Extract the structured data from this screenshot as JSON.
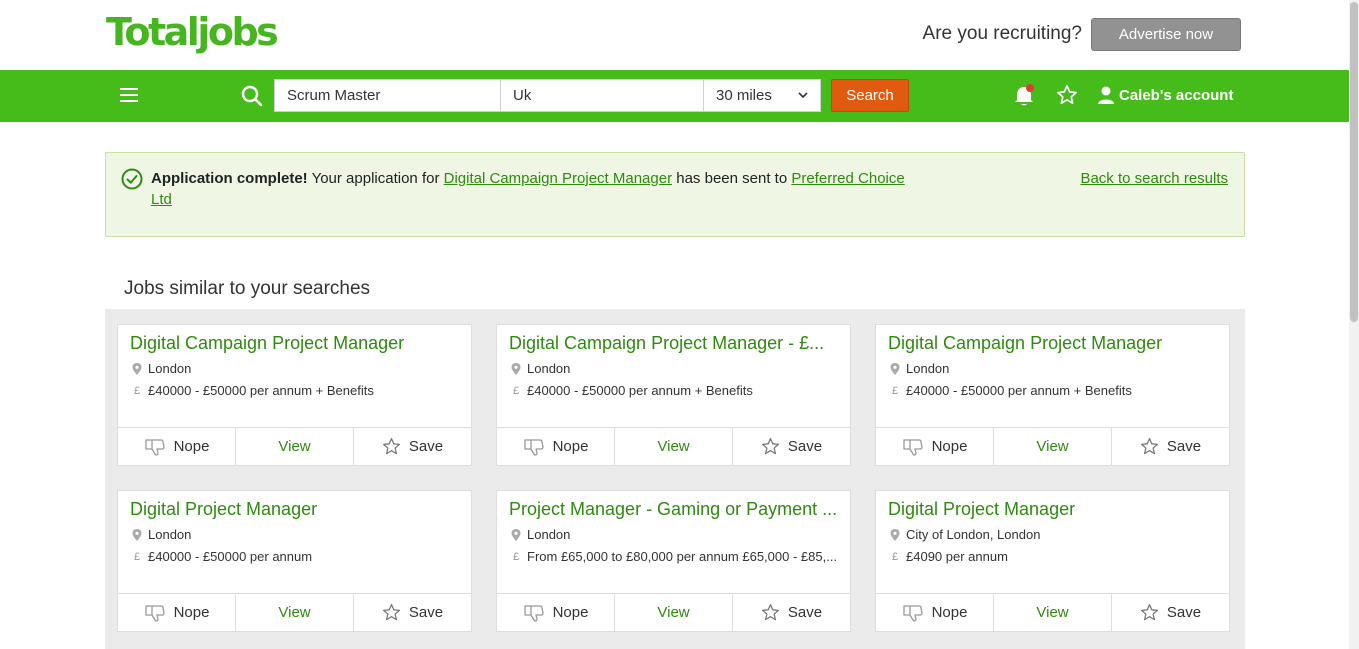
{
  "header": {
    "logo": "Totaljobs",
    "recruit_text": "Are you recruiting?",
    "advertise_label": "Advertise now"
  },
  "nav": {
    "keywords": "Scrum Master",
    "location": "Uk",
    "radius": "30 miles",
    "search_label": "Search",
    "account_label": "Caleb's account"
  },
  "alert": {
    "strong": "Application complete!",
    "text1": " Your application for ",
    "job_link": "Digital Campaign Project Manager",
    "text2": " has been sent to ",
    "company_link": "Preferred Choice Ltd",
    "back_link": "Back to search results"
  },
  "similar": {
    "title": "Jobs similar to your searches",
    "actions": {
      "nope": "Nope",
      "view": "View",
      "save": "Save"
    },
    "jobs": [
      {
        "title": "Digital Campaign Project Manager",
        "location": "London",
        "salary": "£40000 - £50000 per annum + Benefits"
      },
      {
        "title": "Digital Campaign Project Manager - £...",
        "location": "London",
        "salary": "£40000 - £50000 per annum + Benefits"
      },
      {
        "title": "Digital Campaign Project Manager",
        "location": "London",
        "salary": "£40000 - £50000 per annum + Benefits"
      },
      {
        "title": "Digital Project Manager",
        "location": "London",
        "salary": "£40000 - £50000 per annum"
      },
      {
        "title": "Project Manager - Gaming or Payment ...",
        "location": "London",
        "salary": "From £65,000 to £80,000 per annum £65,000 - £85,..."
      },
      {
        "title": "Digital Project Manager",
        "location": "City of London, London",
        "salary": "£4090 per annum"
      }
    ]
  }
}
